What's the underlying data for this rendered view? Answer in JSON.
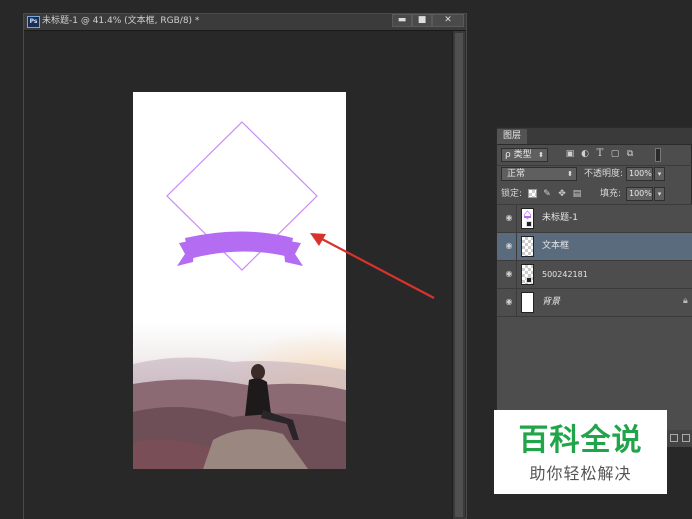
{
  "document": {
    "ps_badge": "Ps",
    "title": "未标题-1 @ 41.4% (文本框, RGB/8) *",
    "controls": {
      "minimize": "▬",
      "maximize": "■",
      "close": "✕"
    }
  },
  "layers_panel": {
    "tab_label": "图层",
    "filter": {
      "search_glyph": "ρ",
      "kind_label": "类型",
      "icons": [
        "image-filter-icon",
        "adjustment-filter-icon",
        "text-filter-icon",
        "shape-filter-icon",
        "smart-object-filter-icon"
      ]
    },
    "blend_mode": "正常",
    "opacity_label": "不透明度:",
    "opacity_value": "100%",
    "lock_label": "锁定:",
    "fill_label": "填充:",
    "fill_value": "100%",
    "layers": [
      {
        "name": "未标题-1",
        "selected": false,
        "thumb": "artwork"
      },
      {
        "name": "文本框",
        "selected": true,
        "thumb": "transparent"
      },
      {
        "name": "500242181",
        "selected": false,
        "thumb": "smart"
      },
      {
        "name": "背景",
        "selected": false,
        "thumb": "white",
        "locked": true
      }
    ]
  },
  "watermark": {
    "title": "百科全说",
    "subtitle": "助你轻松解决"
  },
  "colors": {
    "app_bg": "#282828",
    "accent_purple": "#b36cf2",
    "outline_purple": "#c98af5",
    "arrow_red": "#d9322d",
    "watermark_green": "#22a44a",
    "selected_layer": "#5b6b7e"
  }
}
